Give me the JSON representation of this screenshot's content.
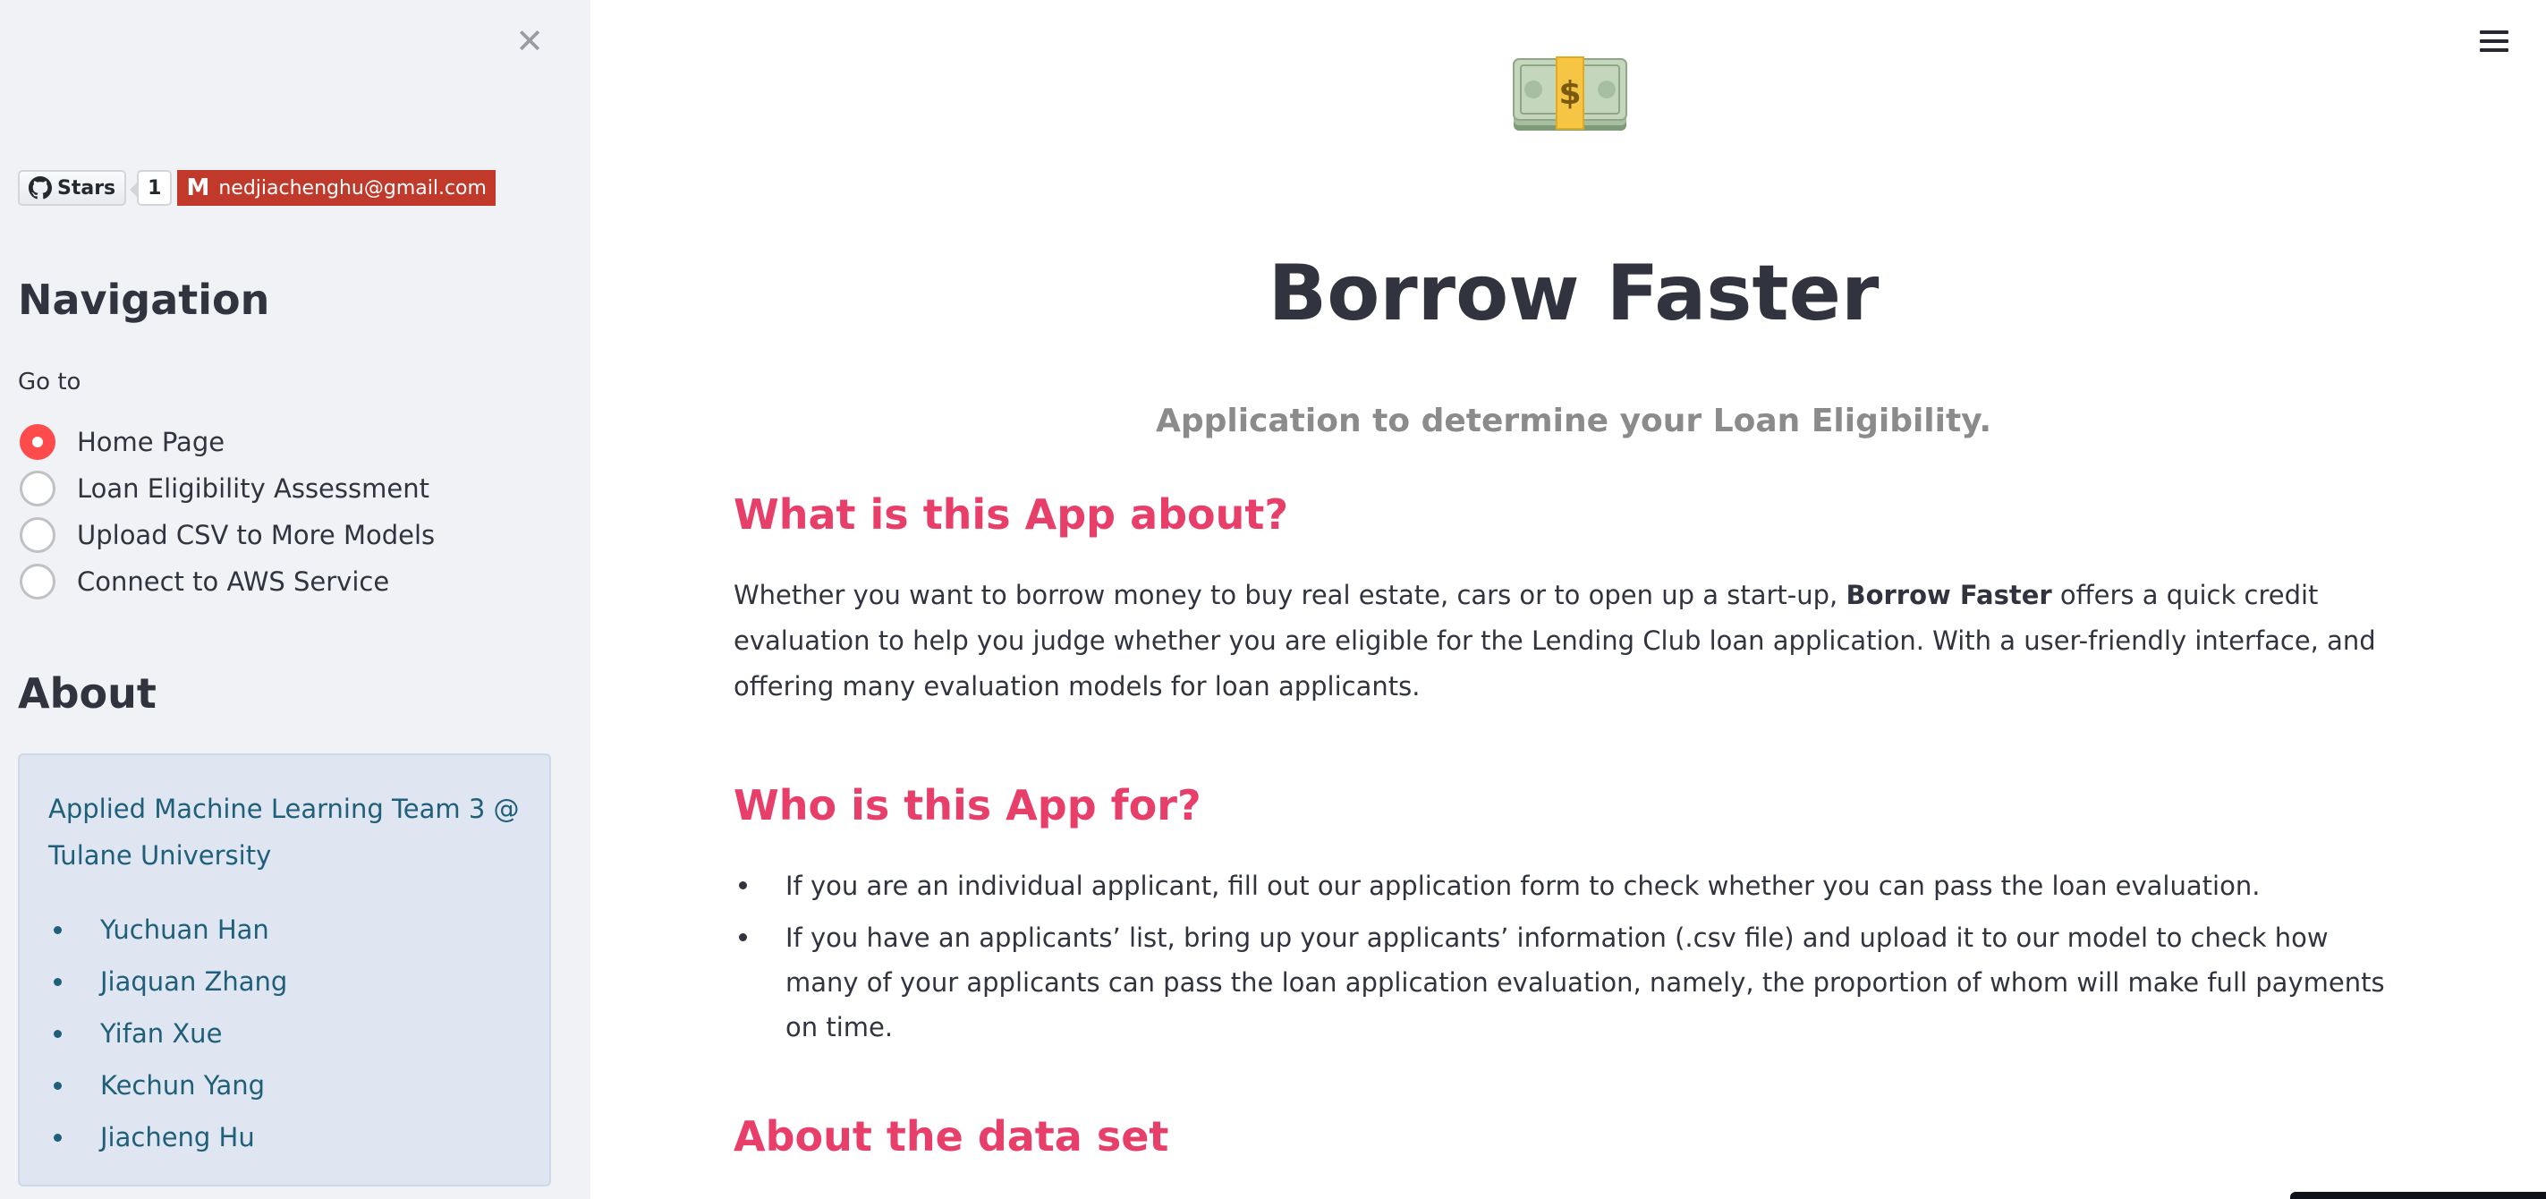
{
  "sidebar": {
    "close_icon": "close-icon",
    "badges": {
      "github_label": "Stars",
      "github_count": "1",
      "email": "nedjiachenghu@gmail.com"
    },
    "navigation_heading": "Navigation",
    "goto_label": "Go to",
    "nav_options": [
      {
        "label": "Home Page",
        "selected": true
      },
      {
        "label": "Loan Eligibility Assessment",
        "selected": false
      },
      {
        "label": "Upload CSV to More Models",
        "selected": false
      },
      {
        "label": "Connect to AWS Service",
        "selected": false
      }
    ],
    "about_heading": "About",
    "about": {
      "team": "Applied Machine Learning Team 3 @ Tulane University",
      "members": [
        "Yuchuan Han",
        "Jiaquan Zhang",
        "Yifan Xue",
        "Kechun Yang",
        "Jiacheng Hu"
      ]
    }
  },
  "main": {
    "menu_icon": "hamburger-menu-icon",
    "logo_icon": "money-bag-icon",
    "title": "Borrow Faster",
    "subtitle": "Application to determine your Loan Eligibility.",
    "sections": {
      "what": {
        "title": "What is this App about?",
        "text_before": "Whether you want to borrow money to buy real estate, cars or to open up a start-up, ",
        "text_bold": "Borrow Faster",
        "text_after": " offers a quick credit evaluation to help you judge whether you are eligible for the Lending Club loan application. With a user-friendly interface, and offering many evaluation models for loan applicants."
      },
      "who": {
        "title": "Who is this App for?",
        "bullets": [
          "If you are an individual applicant, fill out our application form to check whether you can pass the loan evaluation.",
          "If you have an applicants’ list, bring up your applicants’ information (.csv file) and upload it to our model to check how many of your applicants can pass the loan application evaluation, namely, the proportion of whom will make full payments on time."
        ]
      },
      "data": {
        "title": "About the data set"
      }
    }
  },
  "colors": {
    "accent": "#ff4b4b",
    "section_title": "#e83e6a",
    "sidebar_bg": "#f0f2f6",
    "about_box_bg": "#dfe6f1",
    "about_text": "#1f5f7a",
    "gmail_badge": "#c0392b"
  }
}
